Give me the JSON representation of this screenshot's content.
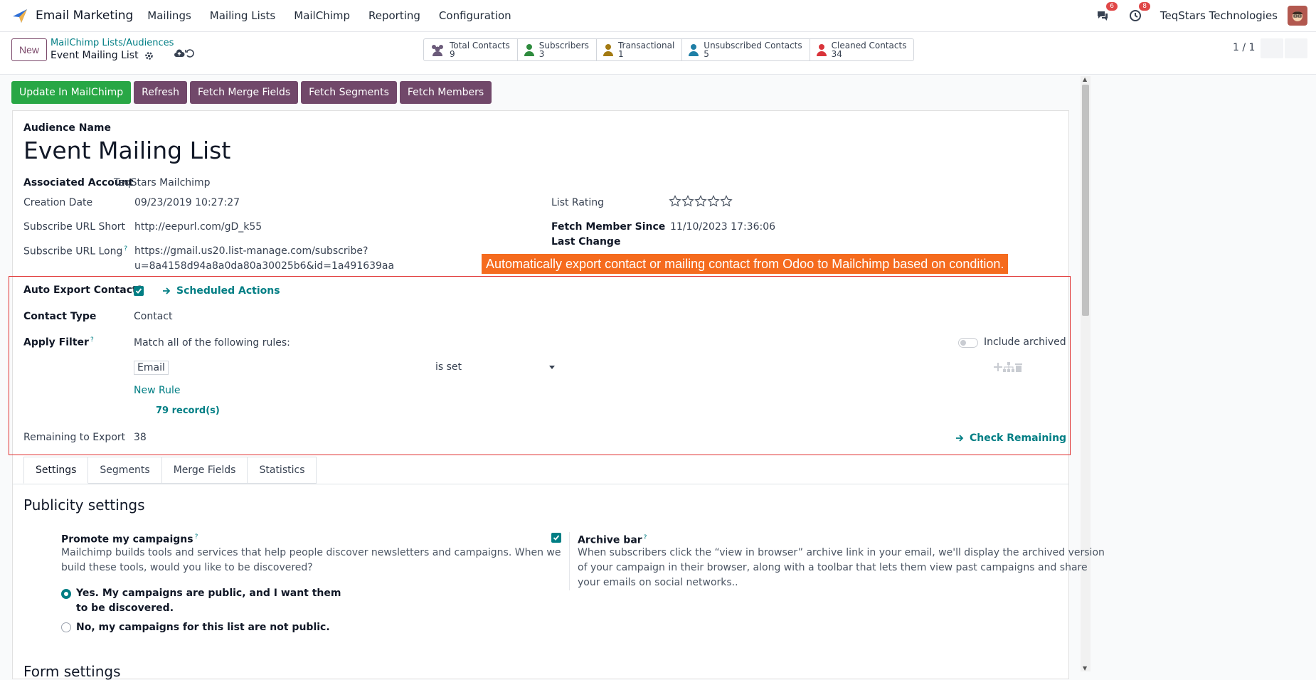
{
  "nav": {
    "app_title": "Email Marketing",
    "menu": [
      "Mailings",
      "Mailing Lists",
      "MailChimp",
      "Reporting",
      "Configuration"
    ],
    "messages_badge": "6",
    "activities_badge": "8",
    "company": "TeqStars Technologies"
  },
  "control": {
    "new_label": "New",
    "breadcrumb_parent": "MailChimp Lists/Audiences",
    "breadcrumb_current": "Event Mailing List",
    "pager": "1 / 1"
  },
  "stats": [
    {
      "label": "Total Contacts",
      "value": "9",
      "color": "#6b5b7a"
    },
    {
      "label": "Subscribers",
      "value": "3",
      "color": "#2e8b3d"
    },
    {
      "label": "Transactional",
      "value": "1",
      "color": "#a37a12"
    },
    {
      "label": "Unsubscribed Contacts",
      "value": "5",
      "color": "#1f7fa6"
    },
    {
      "label": "Cleaned Contacts",
      "value": "34",
      "color": "#d9343a"
    }
  ],
  "actions": [
    "Update In MailChimp",
    "Refresh",
    "Fetch Merge Fields",
    "Fetch Segments",
    "Fetch Members"
  ],
  "form": {
    "audience_name_label": "Audience Name",
    "audience_name": "Event Mailing List",
    "associated_account_label": "Associated Account",
    "associated_account": "TeqStars Mailchimp",
    "creation_date_label": "Creation Date",
    "creation_date": "09/23/2019 10:27:27",
    "subscribe_short_label": "Subscribe URL Short",
    "subscribe_short": "http://eepurl.com/gD_k55",
    "subscribe_long_label": "Subscribe URL Long",
    "subscribe_long_1": "https://gmail.us20.list-manage.com/subscribe?",
    "subscribe_long_2": "u=8a4158d94a8a0da80a30025b6&id=1a491639aa",
    "list_rating_label": "List Rating",
    "list_rating": 0,
    "fetch_member_label_1": "Fetch Member Since",
    "fetch_member_label_2": "Last Change",
    "fetch_member_value": "11/10/2023 17:36:06",
    "callout": "Automatically export contact or mailing contact from Odoo to Mailchimp based on condition.",
    "auto_export_label": "Auto Export Contact?",
    "scheduled_actions": "Scheduled Actions",
    "contact_type_label": "Contact Type",
    "contact_type": "Contact",
    "apply_filter_label": "Apply Filter",
    "match_text": "Match all of the following rules:",
    "include_archived": "Include archived",
    "rule_field": "Email",
    "rule_operator": "is set",
    "new_rule": "New Rule",
    "records": "79 record(s)",
    "remaining_label": "Remaining to Export",
    "remaining_value": "38",
    "check_remaining": "Check Remaining"
  },
  "tabs": [
    "Settings",
    "Segments",
    "Merge Fields",
    "Statistics"
  ],
  "settings": {
    "publicity_title": "Publicity settings",
    "promote_label": "Promote my campaigns",
    "promote_desc_1": "Mailchimp builds tools and services that help people discover newsletters and campaigns. When we",
    "promote_desc_2": "build these tools, would you like to be discovered?",
    "radio_yes_1": "Yes. My campaigns are public, and I want them",
    "radio_yes_2": "to be discovered.",
    "radio_no": "No, my campaigns for this list are not public.",
    "archive_label": "Archive bar",
    "archive_desc_1": "When subscribers click the “view in browser” archive link in your email, we'll display the archived version",
    "archive_desc_2": "of your campaign in their browser, along with a toolbar that lets them view past campaigns and share",
    "archive_desc_3": "your emails on social networks..",
    "form_settings_title": "Form settings"
  }
}
